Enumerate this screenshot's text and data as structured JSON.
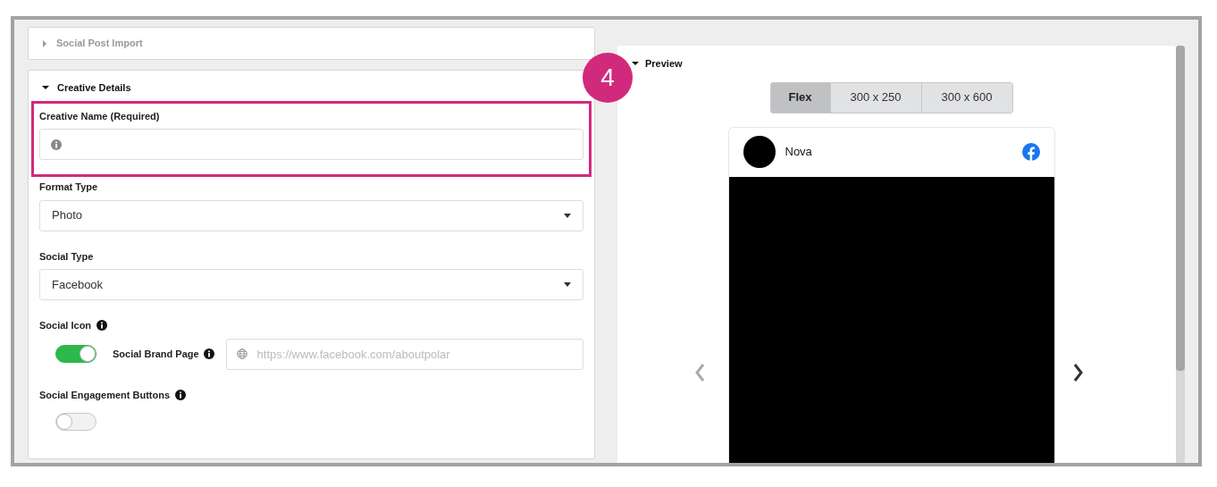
{
  "import_section": {
    "title": "Social Post Import",
    "expanded": false
  },
  "creative_details": {
    "title": "Creative Details",
    "expanded": true,
    "fields": [
      {
        "kind": "text",
        "label": "Creative Name (Required)",
        "highlighted": true
      },
      {
        "kind": "select",
        "label": "Format Type",
        "value": "Photo",
        "highlighted": false
      },
      {
        "kind": "select",
        "label": "Social Type",
        "value": "Facebook",
        "highlighted": false
      },
      {
        "kind": "toggle_url",
        "label": "Social Icon",
        "on": true,
        "sublabel": "Social Brand Page",
        "placeholder": "https://www.facebook.com/aboutpolar",
        "highlighted": false
      },
      {
        "kind": "toggle",
        "label": "Social Engagement Buttons",
        "on": false,
        "highlighted": false
      }
    ]
  },
  "callout": {
    "number": "4"
  },
  "preview": {
    "title": "Preview",
    "expanded": true,
    "tabs": [
      {
        "label": "Flex",
        "selected": true
      },
      {
        "label": "300 x 250",
        "selected": false
      },
      {
        "label": "300 x 600",
        "selected": false
      }
    ],
    "post": {
      "name": "Nova"
    }
  }
}
